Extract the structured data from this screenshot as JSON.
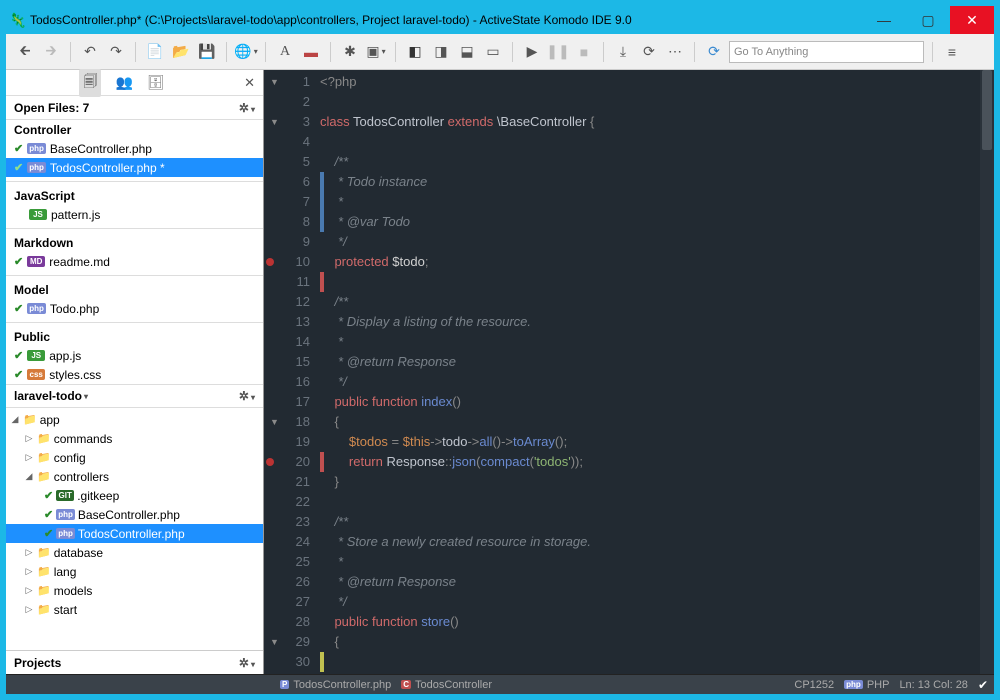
{
  "title": "TodosController.php* (C:\\Projects\\laravel-todo\\app\\controllers, Project laravel-todo) - ActiveState Komodo IDE 9.0",
  "search_placeholder": "Go To Anything",
  "openfiles": {
    "hdr": "Open Files: 7"
  },
  "groups": {
    "controller": "Controller",
    "javascript": "JavaScript",
    "markdown": "Markdown",
    "model": "Model",
    "public": "Public"
  },
  "files": {
    "basectrl": "BaseController.php",
    "todosctrl": "TodosController.php *",
    "pattern": "pattern.js",
    "readme": "readme.md",
    "todo": "Todo.php",
    "appjs": "app.js",
    "styles": "styles.css"
  },
  "project": "laravel-todo",
  "tree": {
    "app": "app",
    "commands": "commands",
    "config": "config",
    "controllers": "controllers",
    "gitkeep": ".gitkeep",
    "basectrl": "BaseController.php",
    "todosctrl": "TodosController.php",
    "database": "database",
    "lang": "lang",
    "models": "models",
    "start": "start"
  },
  "projects_label": "Projects",
  "code": {
    "l1": "<?php",
    "l3a": "class ",
    "l3b": "TodosController ",
    "l3c": "extends ",
    "l3d": "\\BaseController ",
    "l3e": "{",
    "l5": "    /**",
    "l6": "     * Todo instance",
    "l7": "     *",
    "l8": "     * @var Todo",
    "l9": "     */",
    "l10a": "    protected ",
    "l10b": "$todo",
    "l10c": ";",
    "l12": "    /**",
    "l13": "     * Display a listing of the resource.",
    "l14": "     *",
    "l15": "     * @return Response",
    "l16": "     */",
    "l17a": "    public ",
    "l17b": "function ",
    "l17c": "index",
    "l17d": "()",
    "l18": "    {",
    "l19a": "        $todos ",
    "l19b": "= ",
    "l19c": "$this",
    "l19d": "->",
    "l19e": "todo",
    "l19f": "->",
    "l19g": "all",
    "l19h": "()",
    "l19i": "->",
    "l19j": "toArray",
    "l19k": "();",
    "l20a": "        return ",
    "l20b": "Response",
    "l20c": "::",
    "l20d": "json",
    "l20e": "(",
    "l20f": "compact",
    "l20g": "(",
    "l20h": "'todos'",
    "l20i": "));",
    "l21": "    }",
    "l23": "    /**",
    "l24": "     * Store a newly created resource in storage.",
    "l25": "     *",
    "l26": "     * @return Response",
    "l27": "     */",
    "l28a": "    public ",
    "l28b": "function ",
    "l28c": "store",
    "l28d": "()",
    "l29": "    {"
  },
  "status": {
    "tab1": "TodosController.php",
    "tab2": "TodosController",
    "enc": "CP1252",
    "lang": "PHP",
    "pos": "Ln: 13 Col: 28"
  }
}
